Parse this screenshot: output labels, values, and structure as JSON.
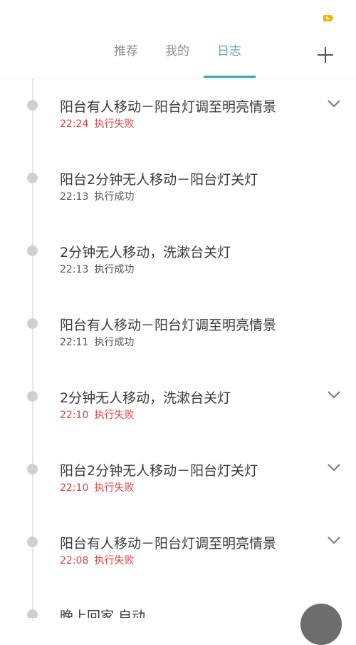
{
  "tabs": [
    {
      "label": "推荐"
    },
    {
      "label": "我的"
    },
    {
      "label": "日志"
    }
  ],
  "entries": [
    {
      "title": "阳台有人移动－阳台灯调至明亮情景",
      "time": "22:24",
      "status": "执行失败"
    },
    {
      "title": "阳台2分钟无人移动－阳台灯关灯",
      "time": "22:13",
      "status": "执行成功"
    },
    {
      "title": "2分钟无人移动，洗漱台关灯",
      "time": "22:13",
      "status": "执行成功"
    },
    {
      "title": "阳台有人移动－阳台灯调至明亮情景",
      "time": "22:11",
      "status": "执行成功"
    },
    {
      "title": "2分钟无人移动，洗漱台关灯",
      "time": "22:10",
      "status": "执行失败"
    },
    {
      "title": "阳台2分钟无人移动－阳台灯关灯",
      "time": "22:10",
      "status": "执行失败"
    },
    {
      "title": "阳台有人移动－阳台灯调至明亮情景",
      "time": "22:08",
      "status": "执行失败"
    },
    {
      "title": "晚上回家 自动",
      "time": "",
      "status": ""
    }
  ],
  "colors": {
    "accent": "#3ba4b0",
    "fail": "#d64545",
    "status_icon": "#f1b400"
  },
  "icons": {
    "status": "battery-charging-icon",
    "add": "plus-icon",
    "expand": "chevron-down-icon",
    "fab": "floating-action-icon"
  }
}
